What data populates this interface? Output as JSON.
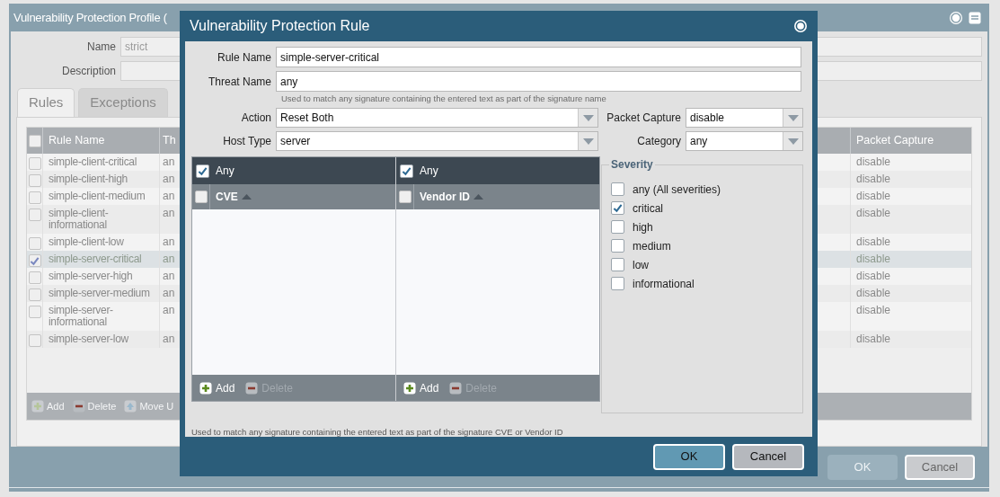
{
  "profile_dialog": {
    "title": "Vulnerability Protection Profile (",
    "name_label": "Name",
    "name_value": "strict",
    "description_label": "Description",
    "tabs": [
      {
        "label": "Rules",
        "selected": true
      },
      {
        "label": "Exceptions",
        "selected": false
      }
    ],
    "table": {
      "header_checkbox": {
        "checked": false
      },
      "columns": [
        "Rule Name",
        "Th",
        "Packet Capture"
      ],
      "rows": [
        {
          "rule_name": "simple-client-critical",
          "column_2": "an",
          "packet_capture": "disable",
          "selected": false
        },
        {
          "rule_name": "simple-client-high",
          "column_2": "an",
          "packet_capture": "disable",
          "selected": false
        },
        {
          "rule_name": "simple-client-medium",
          "column_2": "an",
          "packet_capture": "disable",
          "selected": false
        },
        {
          "rule_name": "simple-client-informational",
          "column_2": "an",
          "packet_capture": "disable",
          "selected": false
        },
        {
          "rule_name": "simple-client-low",
          "column_2": "an",
          "packet_capture": "disable",
          "selected": false
        },
        {
          "rule_name": "simple-server-critical",
          "column_2": "an",
          "packet_capture": "disable",
          "selected": true
        },
        {
          "rule_name": "simple-server-high",
          "column_2": "an",
          "packet_capture": "disable",
          "selected": false
        },
        {
          "rule_name": "simple-server-medium",
          "column_2": "an",
          "packet_capture": "disable",
          "selected": false
        },
        {
          "rule_name": "simple-server-informational",
          "column_2": "an",
          "packet_capture": "disable",
          "selected": false
        },
        {
          "rule_name": "simple-server-low",
          "column_2": "an",
          "packet_capture": "disable",
          "selected": false
        }
      ]
    },
    "toolbar": [
      {
        "kind": "add",
        "label": "Add",
        "disabled": true
      },
      {
        "kind": "delete",
        "label": "Delete",
        "disabled": true
      },
      {
        "kind": "move",
        "label": "Move U",
        "disabled": true
      }
    ],
    "buttons": [
      {
        "label": "OK",
        "disabled": true
      },
      {
        "label": "Cancel",
        "disabled": false
      }
    ]
  },
  "rule_dialog": {
    "title": "Vulnerability Protection Rule",
    "rule_name": {
      "label": "Rule Name",
      "value": "simple-server-critical"
    },
    "threat_name": {
      "label": "Threat Name",
      "value": "any",
      "hint": "Used to match any signature containing the entered text as part of the signature name"
    },
    "action": {
      "label": "Action",
      "value": "Reset Both"
    },
    "host_type": {
      "label": "Host Type",
      "value": "server"
    },
    "packet_capture": {
      "label": "Packet Capture",
      "value": "disable"
    },
    "category": {
      "label": "Category",
      "value": "any"
    },
    "lists": [
      {
        "any": {
          "label": "Any",
          "checked": true
        },
        "header_checkbox": {
          "checked": false
        },
        "column": "CVE",
        "toolbar": [
          {
            "kind": "add",
            "label": "Add",
            "disabled": false
          },
          {
            "kind": "delete",
            "label": "Delete",
            "disabled": true
          }
        ]
      },
      {
        "any": {
          "label": "Any",
          "checked": true
        },
        "header_checkbox": {
          "checked": false
        },
        "column": "Vendor ID",
        "toolbar": [
          {
            "kind": "add",
            "label": "Add",
            "disabled": false
          },
          {
            "kind": "delete",
            "label": "Delete",
            "disabled": true
          }
        ]
      }
    ],
    "severity": {
      "legend": "Severity",
      "items": [
        {
          "label": "any (All severities)",
          "checked": false
        },
        {
          "label": "critical",
          "checked": true
        },
        {
          "label": "high",
          "checked": false
        },
        {
          "label": "medium",
          "checked": false
        },
        {
          "label": "low",
          "checked": false
        },
        {
          "label": "informational",
          "checked": false
        }
      ]
    },
    "footer_hint": "Used to match any signature containing the entered text as part of the signature CVE or Vendor ID",
    "buttons": [
      {
        "kind": "primary",
        "label": "OK"
      },
      {
        "kind": "secondary",
        "label": "Cancel"
      }
    ]
  }
}
